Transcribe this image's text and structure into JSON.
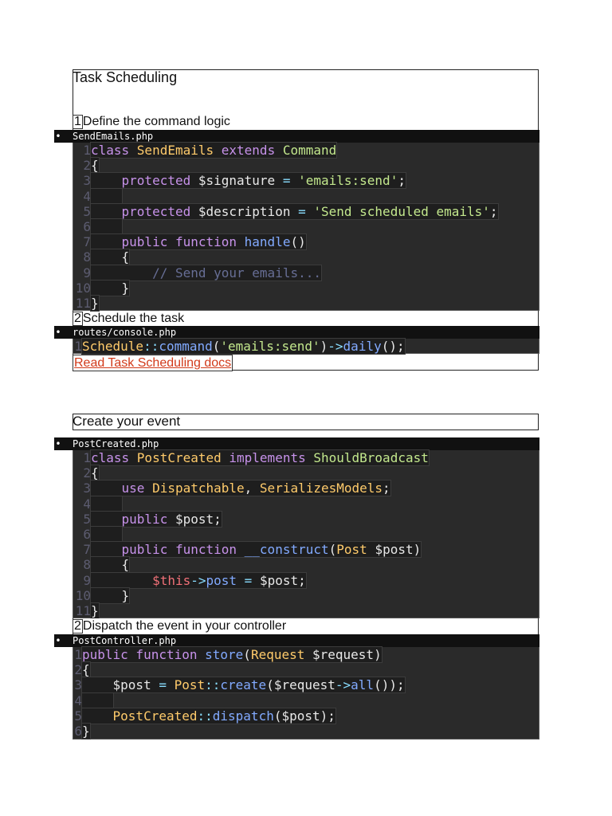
{
  "section1": {
    "title": "Task Scheduling",
    "step1": {
      "num": "1",
      "label": "Define the command logic"
    },
    "file1": "SendEmails.php",
    "step2": {
      "num": "2",
      "label": "Schedule the task"
    },
    "file2": "routes/console.php",
    "link": "Read Task Scheduling docs"
  },
  "section2": {
    "title": "Create your event",
    "file1": "PostCreated.php",
    "step2": {
      "num": "2",
      "label": "Dispatch the event in your controller"
    },
    "file2": "PostController.php"
  },
  "bullet": "•",
  "line_numbers": [
    "1",
    "2",
    "3",
    "4",
    "5",
    "6",
    "7",
    "8",
    "9",
    "10",
    "11"
  ],
  "code": {
    "send_emails": [
      [
        [
          "kw",
          "class "
        ],
        [
          "cls",
          "SendEmails "
        ],
        [
          "kw",
          "extends "
        ],
        [
          "inh",
          "Command"
        ]
      ],
      [
        [
          "plain",
          "{"
        ]
      ],
      [
        [
          "plain",
          "    "
        ],
        [
          "kw",
          "protected "
        ],
        [
          "plain",
          "$signature "
        ],
        [
          "op",
          "= "
        ],
        [
          "str",
          "'emails:send'"
        ],
        [
          "plain",
          ";"
        ]
      ],
      [
        [
          "plain",
          "    "
        ]
      ],
      [
        [
          "plain",
          "    "
        ],
        [
          "kw",
          "protected "
        ],
        [
          "plain",
          "$description "
        ],
        [
          "op",
          "= "
        ],
        [
          "str",
          "'Send scheduled emails'"
        ],
        [
          "plain",
          ";"
        ]
      ],
      [
        [
          "plain",
          "    "
        ]
      ],
      [
        [
          "plain",
          "    "
        ],
        [
          "kw",
          "public function "
        ],
        [
          "fn",
          "handle"
        ],
        [
          "plain",
          "()"
        ]
      ],
      [
        [
          "plain",
          "    {"
        ]
      ],
      [
        [
          "plain",
          "        "
        ],
        [
          "cmt",
          "// Send your emails..."
        ]
      ],
      [
        [
          "plain",
          "    }"
        ]
      ],
      [
        [
          "plain",
          "}"
        ]
      ]
    ],
    "console": [
      [
        [
          "cls",
          "Schedule"
        ],
        [
          "op",
          "::"
        ],
        [
          "fn",
          "command"
        ],
        [
          "plain",
          "("
        ],
        [
          "str",
          "'emails:send'"
        ],
        [
          "plain",
          ")"
        ],
        [
          "op",
          "->"
        ],
        [
          "fn",
          "daily"
        ],
        [
          "plain",
          "();"
        ]
      ]
    ],
    "post_created": [
      [
        [
          "kw",
          "class "
        ],
        [
          "cls",
          "PostCreated "
        ],
        [
          "kw",
          "implements "
        ],
        [
          "inh",
          "ShouldBroadcast"
        ]
      ],
      [
        [
          "plain",
          "{"
        ]
      ],
      [
        [
          "plain",
          "    "
        ],
        [
          "kw",
          "use "
        ],
        [
          "cls",
          "Dispatchable"
        ],
        [
          "plain",
          ", "
        ],
        [
          "cls",
          "SerializesModels"
        ],
        [
          "plain",
          ";"
        ]
      ],
      [
        [
          "plain",
          "    "
        ]
      ],
      [
        [
          "plain",
          "    "
        ],
        [
          "kw",
          "public "
        ],
        [
          "plain",
          "$post;"
        ]
      ],
      [
        [
          "plain",
          "    "
        ]
      ],
      [
        [
          "plain",
          "    "
        ],
        [
          "kw",
          "public function "
        ],
        [
          "fn",
          "__construct"
        ],
        [
          "plain",
          "("
        ],
        [
          "cls",
          "Post "
        ],
        [
          "plain",
          "$post)"
        ]
      ],
      [
        [
          "plain",
          "    {"
        ]
      ],
      [
        [
          "plain",
          "        "
        ],
        [
          "thisv",
          "$this"
        ],
        [
          "op",
          "->"
        ],
        [
          "fn",
          "post "
        ],
        [
          "op",
          "= "
        ],
        [
          "plain",
          "$post;"
        ]
      ],
      [
        [
          "plain",
          "    }"
        ]
      ],
      [
        [
          "plain",
          "}"
        ]
      ]
    ],
    "post_controller": [
      [
        [
          "kw",
          "public function "
        ],
        [
          "fn",
          "store"
        ],
        [
          "plain",
          "("
        ],
        [
          "cls",
          "Request "
        ],
        [
          "plain",
          "$request)"
        ]
      ],
      [
        [
          "plain",
          "{"
        ]
      ],
      [
        [
          "plain",
          "    $post "
        ],
        [
          "op",
          "= "
        ],
        [
          "cls",
          "Post"
        ],
        [
          "op",
          "::"
        ],
        [
          "fn",
          "create"
        ],
        [
          "plain",
          "($request"
        ],
        [
          "op",
          "->"
        ],
        [
          "fn",
          "all"
        ],
        [
          "plain",
          "());"
        ]
      ],
      [
        [
          "plain",
          "    "
        ]
      ],
      [
        [
          "plain",
          "    "
        ],
        [
          "cls",
          "PostCreated"
        ],
        [
          "op",
          "::"
        ],
        [
          "fn",
          "dispatch"
        ],
        [
          "plain",
          "($post);"
        ]
      ],
      [
        [
          "plain",
          "}"
        ]
      ]
    ]
  }
}
